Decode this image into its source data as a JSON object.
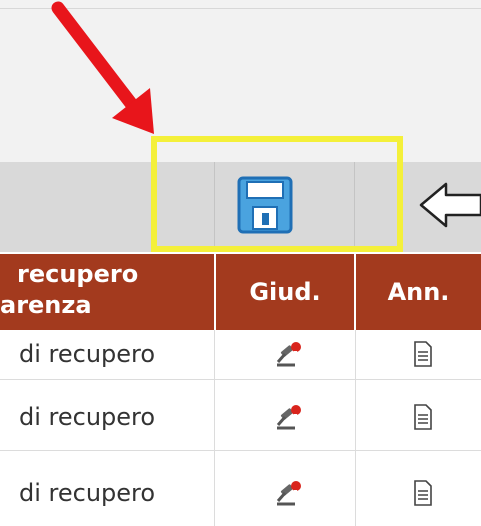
{
  "toolbar": {
    "save_icon": "floppy-disk-save-icon",
    "back_icon": "left-arrow-outline-icon"
  },
  "annotation": {
    "arrow_color": "#e8151b",
    "box_color": "#f4f03a"
  },
  "table": {
    "header_color": "#a33a1e",
    "columns": [
      {
        "label_line1": "recupero",
        "label_line2": "arenza"
      },
      {
        "label": "Giud."
      },
      {
        "label": "Ann."
      }
    ],
    "rows": [
      {
        "text": "di recupero",
        "giud_icon": "gavel-icon",
        "ann_icon": "document-icon"
      },
      {
        "text": "di recupero",
        "giud_icon": "gavel-icon",
        "ann_icon": "document-icon"
      },
      {
        "text": "di recupero",
        "giud_icon": "gavel-icon",
        "ann_icon": "document-icon"
      }
    ]
  }
}
